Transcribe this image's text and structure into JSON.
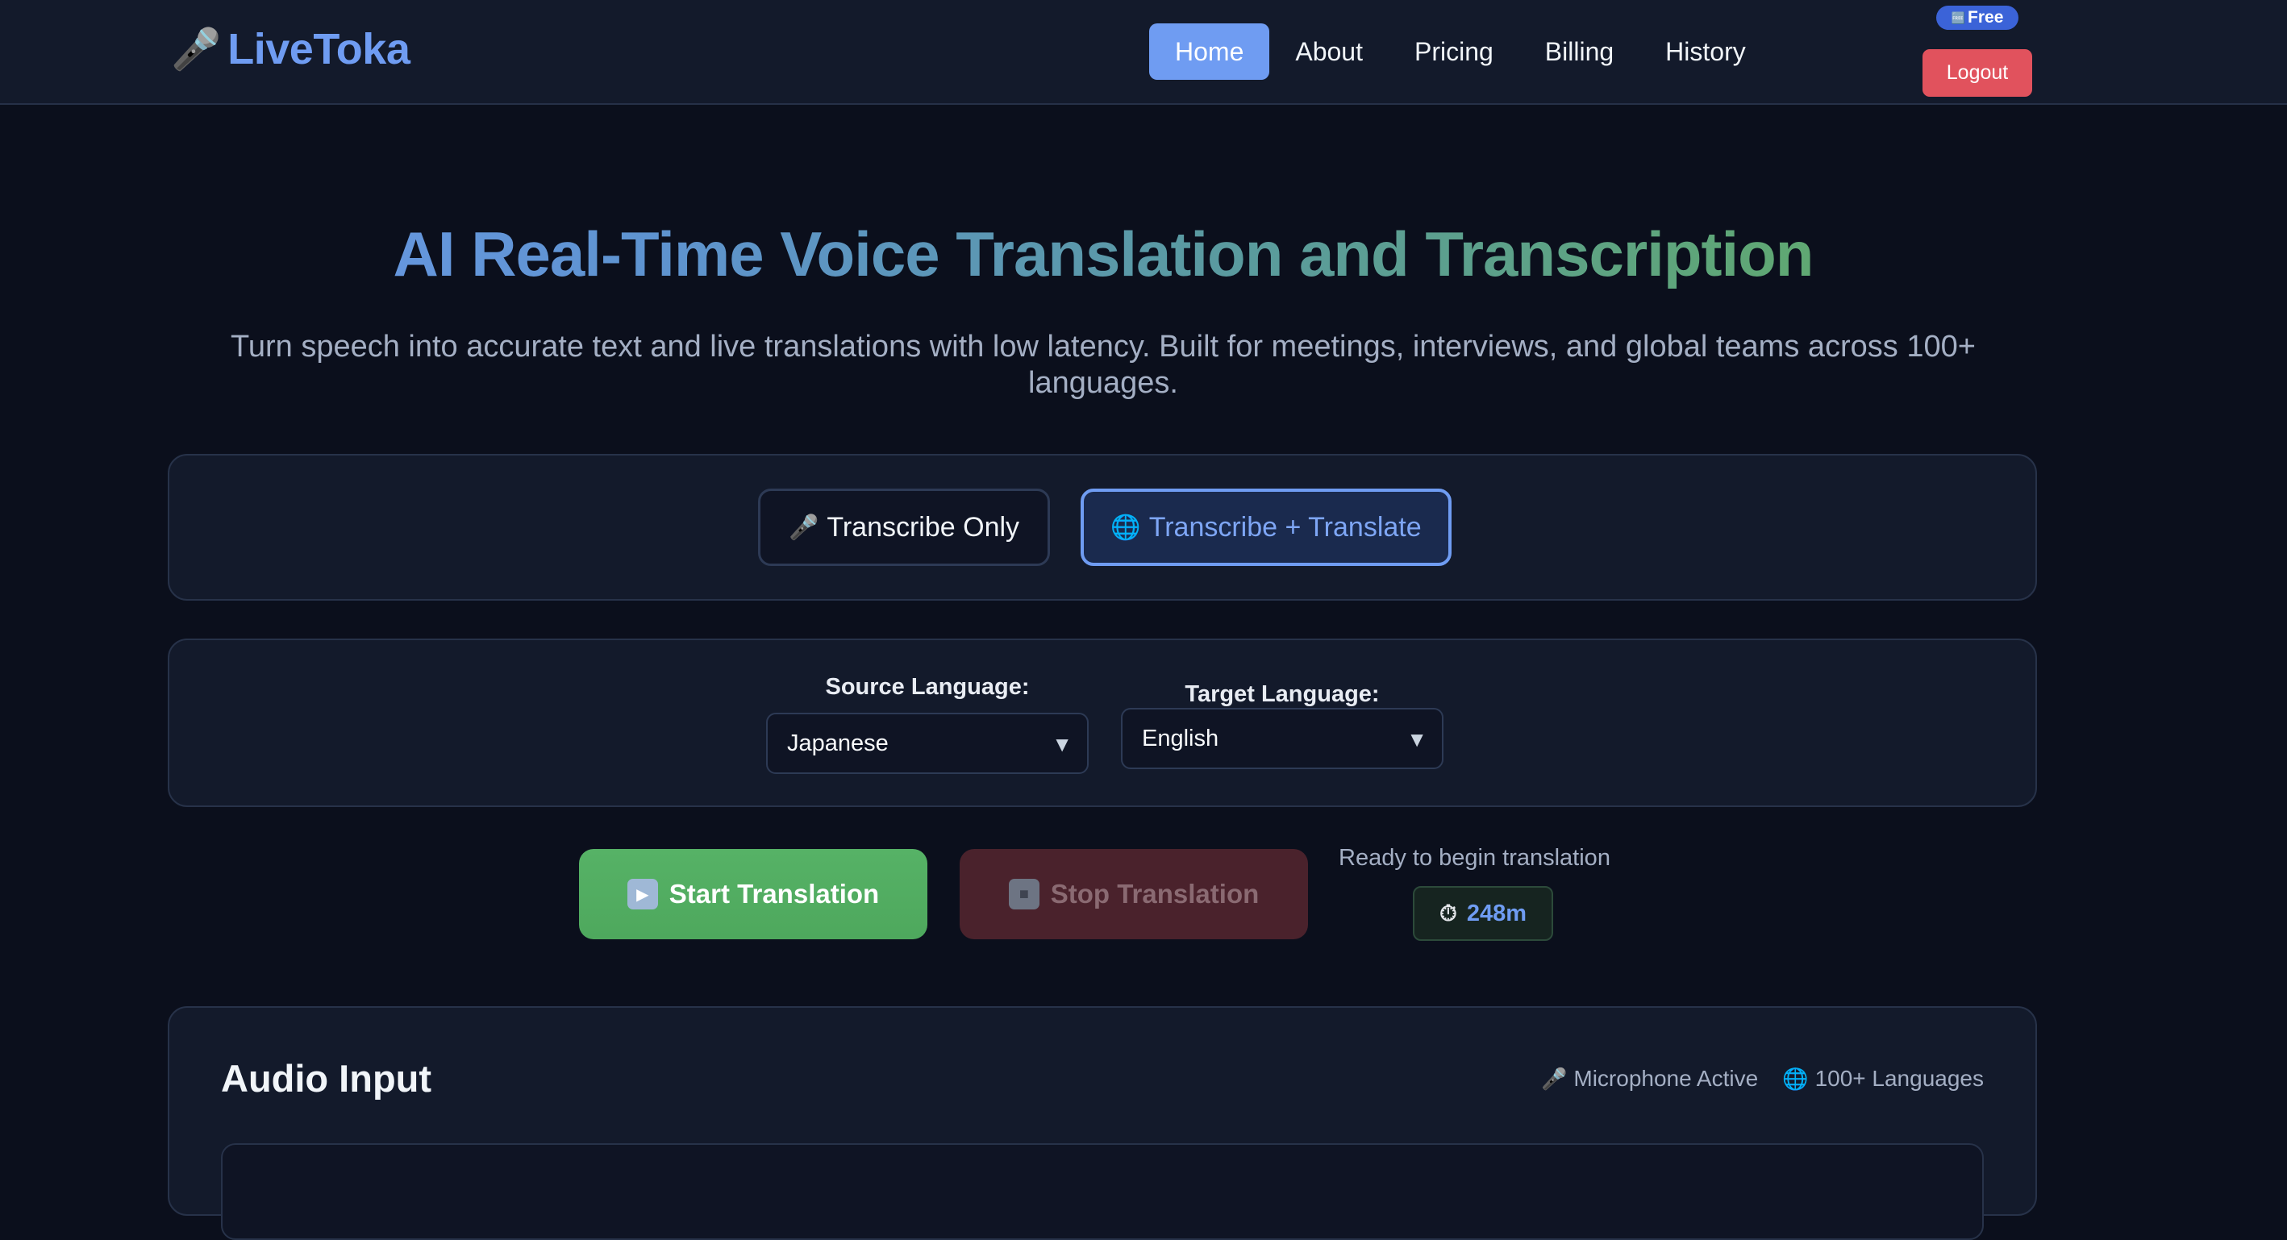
{
  "header": {
    "logo_icon": "microphone-icon",
    "logo_text": "LiveToka",
    "nav": [
      {
        "label": "Home",
        "active": true
      },
      {
        "label": "About",
        "active": false
      },
      {
        "label": "Pricing",
        "active": false
      },
      {
        "label": "Billing",
        "active": false
      },
      {
        "label": "History",
        "active": false
      }
    ],
    "plan_badge": "Free",
    "logout_label": "Logout"
  },
  "hero": {
    "title": "AI Real-Time Voice Translation and Transcription",
    "subtitle": "Turn speech into accurate text and live translations with low latency. Built for meetings, interviews, and global teams across 100+ languages."
  },
  "modes": {
    "transcribe_label": "Transcribe Only",
    "translate_label": "Transcribe + Translate",
    "selected": "Transcribe + Translate"
  },
  "languages": {
    "source_label": "Source Language:",
    "source_value": "Japanese",
    "target_label": "Target Language:",
    "target_value": "English"
  },
  "controls": {
    "start_label": "Start Translation",
    "stop_label": "Stop Translation",
    "status": "Ready to begin translation",
    "time_remaining": "248m"
  },
  "audio": {
    "title": "Audio Input",
    "mic_status": "Microphone Active",
    "languages_count": "100+ Languages"
  },
  "colors": {
    "accent": "#6f9cf2",
    "start": "#56b266",
    "logout": "#e1525d",
    "background": "#0b0f1c",
    "panel": "#131a2b"
  }
}
